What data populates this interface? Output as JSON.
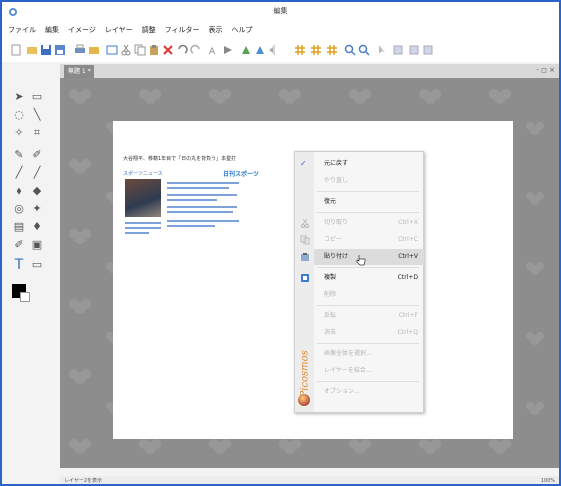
{
  "window": {
    "title": "編集"
  },
  "menubar": {
    "items": [
      "ファイル",
      "編集",
      "イメージ",
      "レイヤー",
      "調整",
      "フィルター",
      "表示",
      "ヘルプ"
    ]
  },
  "tabs": {
    "doc_tab": "無題 1 *",
    "controls": "- ◻ ×"
  },
  "context_menu": {
    "brand": "Picosmos",
    "items": [
      {
        "label": "元に戻す",
        "shortcut": "",
        "enabled": true,
        "check": true
      },
      {
        "label": "やり直し",
        "shortcut": "",
        "enabled": false
      },
      {
        "label": "復元",
        "shortcut": "",
        "enabled": true
      },
      {
        "label": "切り取り",
        "shortcut": "Ctrl+X",
        "enabled": false
      },
      {
        "label": "コピー",
        "shortcut": "Ctrl+C",
        "enabled": false
      },
      {
        "label": "貼り付け",
        "shortcut": "Ctrl+V",
        "enabled": true,
        "highlighted": true
      },
      {
        "label": "複製",
        "shortcut": "Ctrl+D",
        "enabled": true
      },
      {
        "label": "削除",
        "shortcut": "",
        "enabled": false
      },
      {
        "label": "反転",
        "shortcut": "Ctrl+F",
        "enabled": false
      },
      {
        "label": "消去",
        "shortcut": "Ctrl+Q",
        "enabled": false
      },
      {
        "label": "画像全体を選択...",
        "shortcut": "",
        "enabled": false
      },
      {
        "label": "レイヤーを結合...",
        "shortcut": "",
        "enabled": false
      },
      {
        "label": "オプション...",
        "shortcut": "",
        "enabled": false
      }
    ]
  },
  "news_snippet": {
    "headline": "大谷翔平、移籍1年目で「日の丸を背負う」本塁打",
    "source": "スポーツニュース",
    "brand": "日刊スポーツ"
  },
  "statusbar": {
    "left": "レイヤー2を表示",
    "right": "100%"
  },
  "colors": {
    "accent": "#2a64c8",
    "canvas_bg": "#8d8d8d",
    "brand_orange": "#e08a28"
  }
}
